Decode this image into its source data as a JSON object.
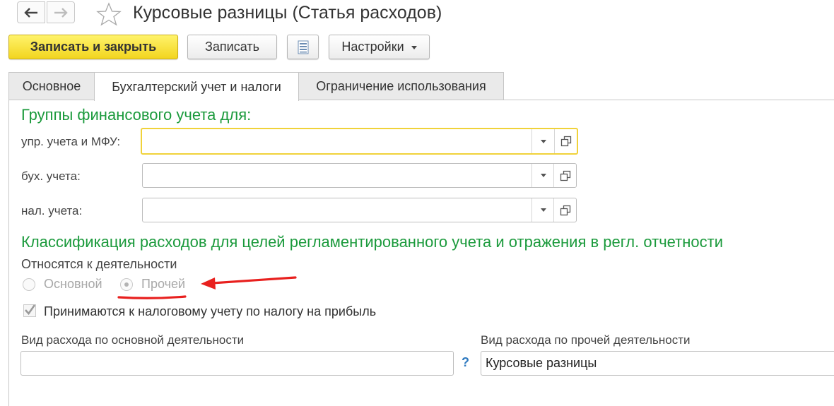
{
  "window": {
    "title": "Курсовые разницы (Статья расходов)"
  },
  "toolbar": {
    "save_close_label": "Записать и закрыть",
    "save_label": "Записать",
    "settings_label": "Настройки"
  },
  "tabs": [
    {
      "label": "Основное",
      "active": false
    },
    {
      "label": "Бухгалтерский учет и налоги",
      "active": true
    },
    {
      "label": "Ограничение использования",
      "active": false
    }
  ],
  "financial_groups": {
    "title": "Группы финансового учета для:",
    "fields": [
      {
        "label": "упр. учета и МФУ:",
        "value": ""
      },
      {
        "label": "бух. учета:",
        "value": ""
      },
      {
        "label": "нал. учета:",
        "value": ""
      }
    ]
  },
  "classification": {
    "title": "Классификация расходов для целей регламентированного учета и отражения в регл. отчетности",
    "activity_label": "Относятся к деятельности",
    "options": [
      {
        "label": "Основной",
        "selected": false
      },
      {
        "label": "Прочей",
        "selected": true
      }
    ],
    "tax_checkbox_label": "Принимаются к налоговому учету по налогу на прибыль",
    "tax_checkbox_checked": true
  },
  "expense_kinds": {
    "main_label": "Вид расхода по основной деятельности",
    "main_value": "",
    "help_mark": "?",
    "other_label": "Вид расхода по прочей деятельности",
    "other_value": "Курсовые разницы"
  },
  "colors": {
    "section_green": "#1b9a3c",
    "primary_button": "#f2d51f",
    "annotation_red": "#e8201e"
  }
}
